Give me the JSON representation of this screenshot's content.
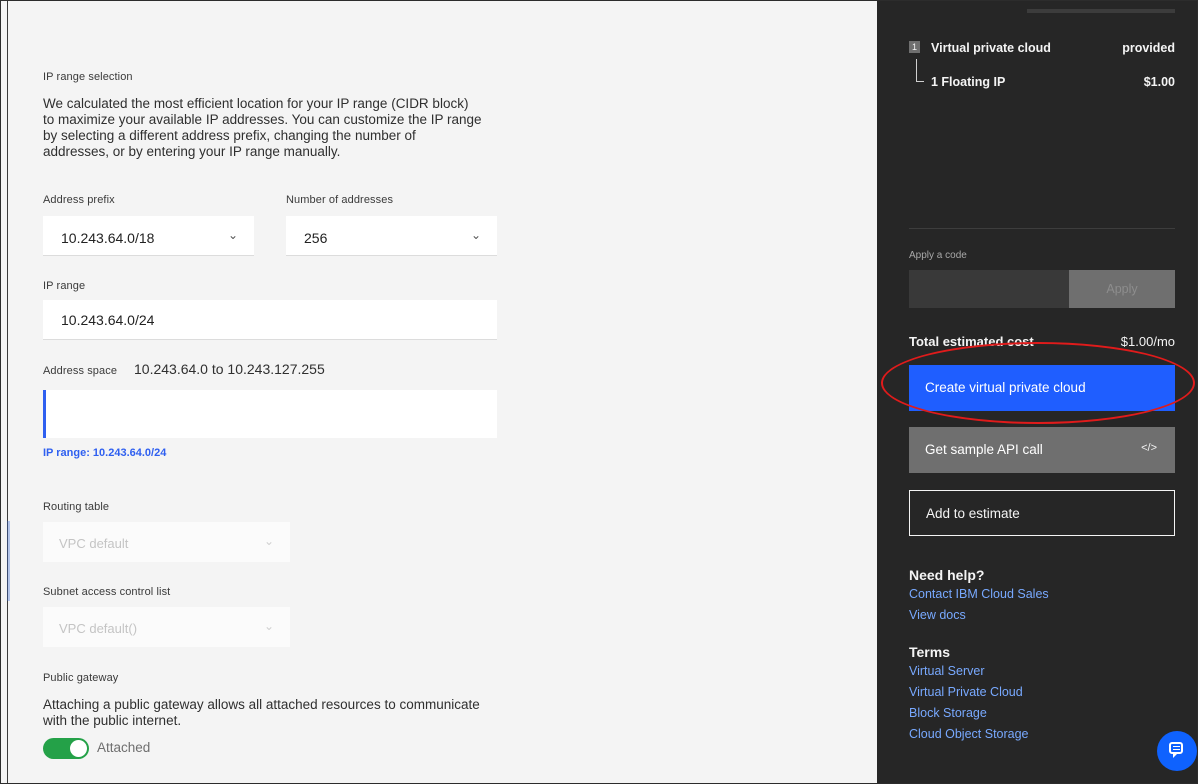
{
  "ip_range_section": {
    "title": "IP range selection",
    "description": "We calculated the most efficient location for your IP range (CIDR block) to maximize your available IP addresses. You can customize the IP range by selecting a different address prefix, changing the number of addresses, or by entering your IP range manually.",
    "description_lines": [
      "We calculated the most efficient location for your IP range (CIDR block)",
      "to maximize your available IP addresses. You can customize the IP range",
      "by selecting a different address prefix, changing the number of",
      "addresses, or by entering your IP range manually."
    ],
    "address_prefix_label": "Address prefix",
    "address_prefix_value": "10.243.64.0/18",
    "number_of_addresses_label": "Number of addresses",
    "number_of_addresses_value": "256",
    "ip_range_label": "IP range",
    "ip_range_value": "10.243.64.0/24",
    "address_space_label": "Address space",
    "address_space_value": "10.243.64.0 to 10.243.127.255",
    "ip_range_hint": "IP range: 10.243.64.0/24"
  },
  "routing_table": {
    "label": "Routing table",
    "value": "VPC default"
  },
  "subnet_acl": {
    "label": "Subnet access control list",
    "value": "VPC default()"
  },
  "public_gateway": {
    "label": "Public gateway",
    "description_lines": [
      "Attaching a public gateway allows all attached resources to communicate",
      "with the public internet."
    ],
    "toggle_label": "Attached",
    "enabled": true
  },
  "summary": {
    "step_number": "1",
    "item_name": "Virtual private cloud",
    "item_price": "provided",
    "sub_item_name": "1 Floating IP",
    "sub_item_price": "$1.00"
  },
  "promo": {
    "label": "Apply a code",
    "input_value": "",
    "apply_button": "Apply"
  },
  "total": {
    "label": "Total estimated cost",
    "value": "$1.00/mo"
  },
  "actions": {
    "create": "Create virtual private cloud",
    "sample_api": "Get sample API call",
    "sample_api_icon": "</>",
    "add_estimate": "Add to estimate"
  },
  "help": {
    "title": "Need help?",
    "links": [
      "Contact IBM Cloud Sales",
      "View docs"
    ]
  },
  "terms": {
    "title": "Terms",
    "links": [
      "Virtual Server",
      "Virtual Private Cloud",
      "Block Storage",
      "Cloud Object Storage"
    ]
  },
  "colors": {
    "primary_button": "#1f5eff",
    "link": "#78a9ff",
    "toggle_on": "#24a148",
    "highlight": "#e01b1b",
    "panel": "#262626"
  }
}
